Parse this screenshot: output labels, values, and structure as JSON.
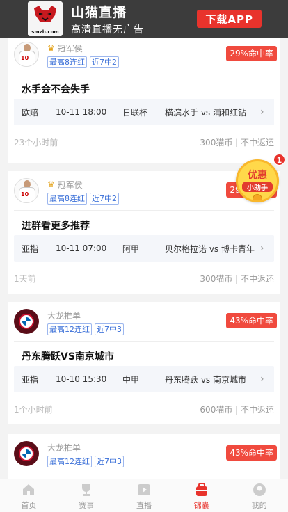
{
  "banner": {
    "app_name": "山猫直播",
    "slogan": "高清直播无广告",
    "logo_domain": "smzb.com",
    "download_label": "下载APP"
  },
  "cards": [
    {
      "author": "冠军侯",
      "avatar": "player",
      "crown": true,
      "tags": [
        "最高8连红",
        "近7中2"
      ],
      "hit_rate": "29%命中率",
      "title": "水手会不会失手",
      "match_type": "欧赔",
      "match_time": "10-11 18:00",
      "league": "日联杯",
      "teams": "横滨水手 vs 浦和红钻",
      "ago": "23个小时前",
      "price": "300猫币 | 不中返还"
    },
    {
      "author": "冠军侯",
      "avatar": "player",
      "crown": true,
      "tags": [
        "最高8连红",
        "近7中2"
      ],
      "hit_rate": "29%命中率",
      "title": "进群看更多推荐",
      "match_type": "亚指",
      "match_time": "10-11 07:00",
      "league": "阿甲",
      "teams": "贝尔格拉诺 vs 博卡青年",
      "ago": "1天前",
      "price": "300猫币 | 不中返还"
    },
    {
      "author": "大龙推单",
      "avatar": "bayern",
      "crown": false,
      "tags": [
        "最高12连红",
        "近7中3"
      ],
      "hit_rate": "43%命中率",
      "title": "丹东腾跃VS南京城市",
      "match_type": "亚指",
      "match_time": "10-10 15:30",
      "league": "中甲",
      "teams": "丹东腾跃 vs 南京城市",
      "ago": "1个小时前",
      "price": "600猫币 | 不中返还"
    },
    {
      "author": "大龙推单",
      "avatar": "bayern",
      "crown": false,
      "tags": [
        "最高12连红",
        "近7中3"
      ],
      "hit_rate": "43%命中率"
    }
  ],
  "promo": {
    "line1": "优惠",
    "line2": "小助手",
    "badge": "1"
  },
  "tabbar": [
    {
      "label": "首页",
      "icon": "home-icon",
      "active": false
    },
    {
      "label": "赛事",
      "icon": "trophy-icon",
      "active": false
    },
    {
      "label": "直播",
      "icon": "play-icon",
      "active": false
    },
    {
      "label": "锦囊",
      "icon": "tips-bag-icon",
      "active": true
    },
    {
      "label": "我的",
      "icon": "user-icon",
      "active": false
    }
  ],
  "colors": {
    "accent": "#e8332c",
    "tag_blue": "#3a6fd8",
    "banner_bg": "#3c3c3c"
  }
}
